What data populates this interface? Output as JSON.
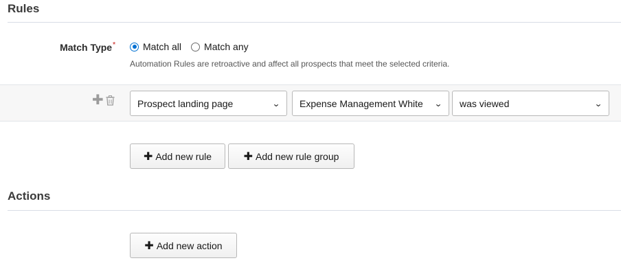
{
  "rules_section": {
    "title": "Rules"
  },
  "match_type": {
    "label": "Match Type",
    "required_marker": "*",
    "options": [
      {
        "label": "Match all",
        "selected": true
      },
      {
        "label": "Match any",
        "selected": false
      }
    ],
    "help_text": "Automation Rules are retroactive and affect all prospects that meet the selected criteria."
  },
  "rule_row": {
    "add_icon": "plus-icon",
    "delete_icon": "trash-icon",
    "selects": [
      {
        "value": "Prospect landing page"
      },
      {
        "value": "Expense Management White"
      },
      {
        "value": "was viewed"
      }
    ]
  },
  "rule_buttons": {
    "add_rule": "Add new rule",
    "add_rule_group": "Add new rule group"
  },
  "actions_section": {
    "title": "Actions"
  },
  "action_buttons": {
    "add_action": "Add new action"
  },
  "colors": {
    "accent": "#0070d2",
    "required": "#d4504c"
  }
}
